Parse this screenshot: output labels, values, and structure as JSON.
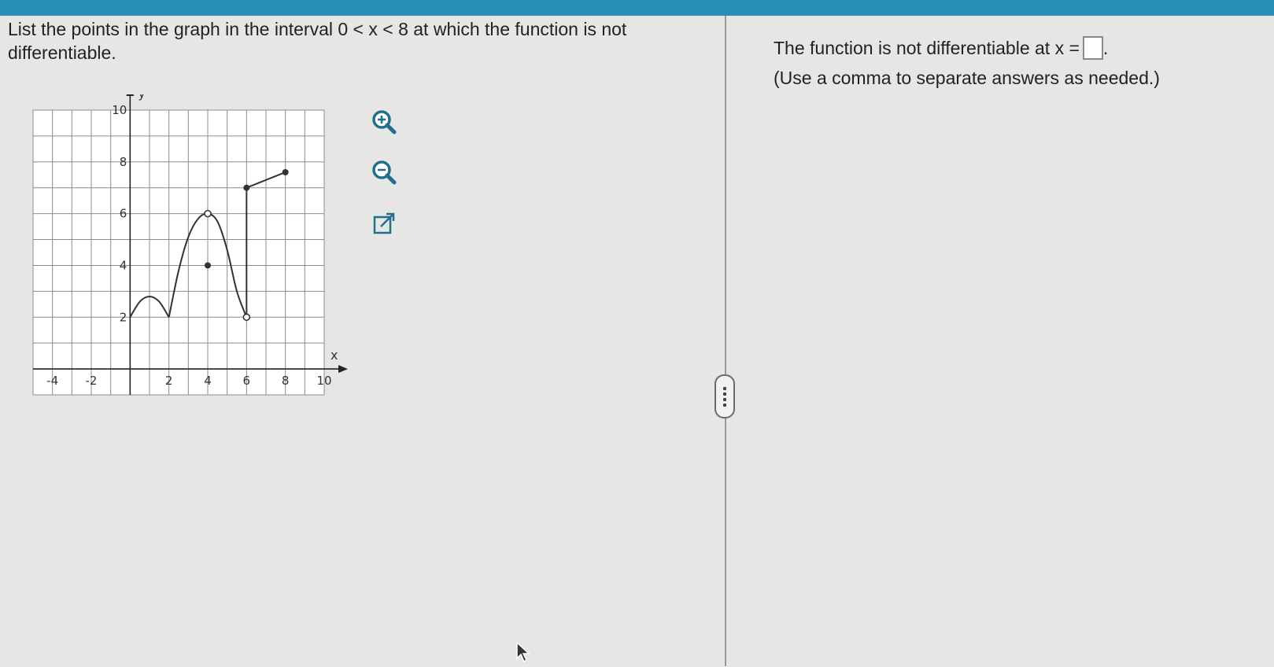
{
  "colors": {
    "topbar": "#2a8fb8",
    "background": "#e6e6e4",
    "graph_background": "#ffffff",
    "grid": "#8c8c8c",
    "curve": "#333333",
    "tool_icon": "#1f6f8f"
  },
  "question": {
    "text": "List the points in the graph in the interval 0 < x < 8 at which the function is not differentiable."
  },
  "graph": {
    "y_axis_label": "y",
    "x_axis_label": "x",
    "x_ticks": [
      "-4",
      "-2",
      "2",
      "4",
      "6",
      "8",
      "10"
    ],
    "y_ticks": [
      "10",
      "8",
      "6",
      "4",
      "2"
    ],
    "x_range": [
      -5,
      10
    ],
    "y_range": [
      -1,
      10
    ]
  },
  "chart_data": {
    "type": "line",
    "xlim": [
      -5,
      10
    ],
    "ylim": [
      -1,
      10
    ],
    "grid": true,
    "segments": [
      {
        "kind": "curve",
        "points": [
          [
            0,
            2
          ],
          [
            0.5,
            2.6
          ],
          [
            1,
            2.8
          ],
          [
            1.5,
            2.6
          ],
          [
            2,
            2
          ]
        ]
      },
      {
        "kind": "curve",
        "points": [
          [
            2,
            2
          ],
          [
            2.5,
            3.8
          ],
          [
            3,
            5.1
          ],
          [
            3.5,
            5.8
          ],
          [
            4,
            6
          ],
          [
            4.5,
            5.7
          ],
          [
            5,
            4.6
          ],
          [
            5.5,
            3
          ],
          [
            6,
            2
          ]
        ]
      },
      {
        "kind": "line",
        "points": [
          [
            6,
            7
          ],
          [
            8,
            7.6
          ]
        ]
      }
    ],
    "vertical_line": [
      [
        6,
        2
      ],
      [
        6,
        7
      ]
    ],
    "open_points": [
      [
        4,
        6
      ],
      [
        6,
        2
      ]
    ],
    "closed_points": [
      [
        4,
        4
      ],
      [
        6,
        7
      ],
      [
        8,
        7.6
      ]
    ]
  },
  "tools": {
    "zoom_in_icon": "zoom-in-icon",
    "zoom_out_icon": "zoom-out-icon",
    "popout_icon": "external-link-icon"
  },
  "answer": {
    "prompt": "The function is not differentiable at x =",
    "value": "",
    "trailing": ".",
    "note": "(Use a comma to separate answers as needed.)"
  }
}
